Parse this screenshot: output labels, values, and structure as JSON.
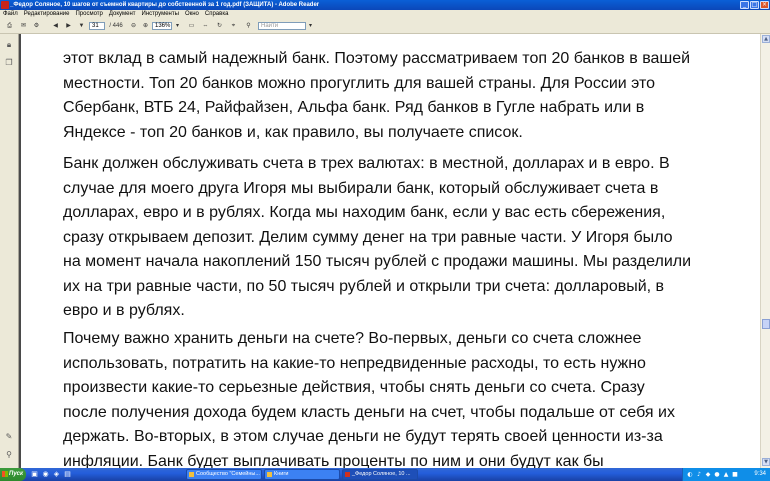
{
  "window": {
    "title": "_Федор Соляное, 10 шагов от съемной квартиры до собственной за 1 год.pdf (ЗАЩИТА) - Adobe Reader",
    "minimize_glyph": "_",
    "maximize_glyph": "□",
    "close_glyph": "×"
  },
  "menu": {
    "items": [
      "Файл",
      "Редактирование",
      "Просмотр",
      "Документ",
      "Инструменты",
      "Окно",
      "Справка"
    ]
  },
  "toolbar": {
    "page_number": "31",
    "page_total": "/ 446",
    "zoom": "136%",
    "search_placeholder": "Найти"
  },
  "document": {
    "paragraphs": [
      [
        "этот вклад в самый надежный банк. Поэтому рассматриваем топ 20 банков в вашей",
        "местности. Топ 20 банков можно прогуглить для вашей страны. Для России это",
        "Сбербанк, ВТБ 24, Райфайзен, Альфа банк. Ряд банков в Гугле набрать или в",
        "Яндексе - топ 20 банков и, как правило, вы получаете список."
      ],
      [
        "Банк должен обслуживать счета в трех валютах: в местной, долларах и в евро. В",
        "случае для моего друга Игоря мы выбирали банк, который обслуживает счета в",
        "долларах, евро и  в рублях. Когда мы находим банк, если у вас есть сбережения,",
        "сразу открываем депозит. Делим сумму денег на три равные части. У Игоря было",
        "на момент начала накоплений 150 тысяч рублей с продажи машины. Мы разделили",
        "их на три равные части, по 50 тысяч рублей и открыли три счета: долларовый, в",
        "евро и в рублях."
      ],
      [
        "Почему важно хранить деньги на счете? Во-первых, деньги со счета сложнее",
        "использовать, потратить на какие-то непредвиденные расходы, то есть нужно",
        "произвести какие-то серьезные действия, чтобы снять деньги со счета. Сразу",
        "после получения дохода будем класть деньги на счет, чтобы подальше от себя их",
        "держать.  Во-вторых, в этом случае деньги не будут терять своей ценности из-за",
        "инфляции. Банк будет выплачивать проценты по ним и они будут как бы"
      ]
    ]
  },
  "taskbar": {
    "start_label": "Пуск",
    "tasks": [
      "Сообщество \"Семейны...",
      "Книги",
      "_Федор Соляное, 10 ..."
    ],
    "clock": "9:34"
  }
}
